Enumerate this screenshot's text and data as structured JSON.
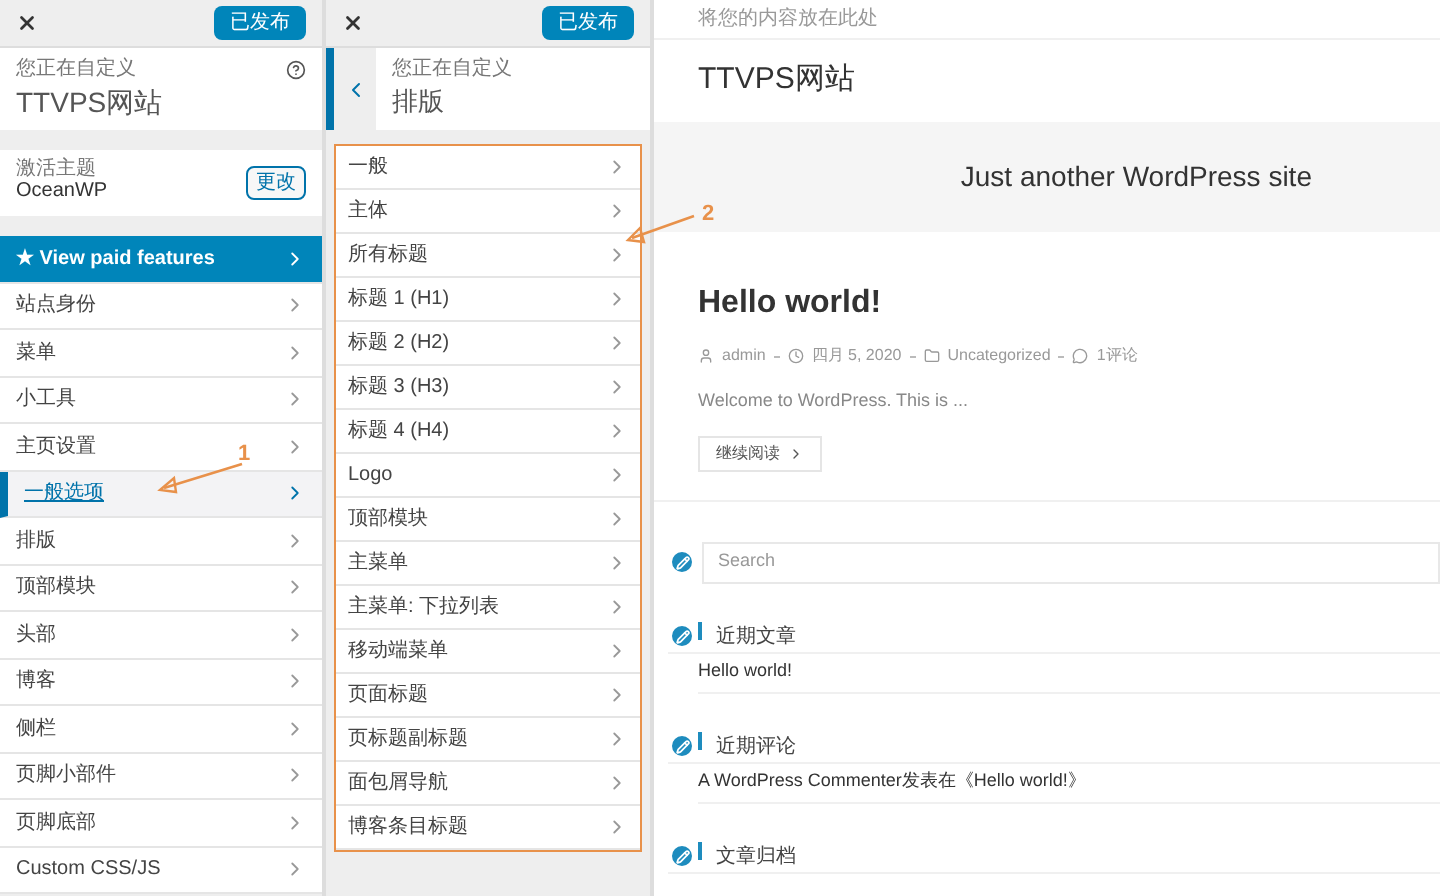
{
  "panel_1": {
    "publish_button": "已发布",
    "customizing_label": "您正在自定义",
    "site_title": "TTVPS网站",
    "active_theme": {
      "label": "激活主题",
      "name": "OceanWP",
      "button": "更改"
    },
    "items": [
      {
        "label": "★ View paid features",
        "kind": "promo",
        "selected": false
      },
      {
        "label": "站点身份",
        "kind": "section",
        "selected": false
      },
      {
        "label": "菜单",
        "kind": "section",
        "selected": false
      },
      {
        "label": "小工具",
        "kind": "section",
        "selected": false
      },
      {
        "label": "主页设置",
        "kind": "section",
        "selected": false
      },
      {
        "label": "一般选项",
        "kind": "section",
        "selected": true
      },
      {
        "label": "排版",
        "kind": "section",
        "selected": false
      },
      {
        "label": "顶部模块",
        "kind": "section",
        "selected": false
      },
      {
        "label": "头部",
        "kind": "section",
        "selected": false
      },
      {
        "label": "博客",
        "kind": "section",
        "selected": false
      },
      {
        "label": "侧栏",
        "kind": "section",
        "selected": false
      },
      {
        "label": "页脚小部件",
        "kind": "section",
        "selected": false
      },
      {
        "label": "页脚底部",
        "kind": "section",
        "selected": false
      },
      {
        "label": "Custom CSS/JS",
        "kind": "section",
        "selected": false
      }
    ]
  },
  "panel_2": {
    "publish_button": "已发布",
    "customizing_label": "您正在自定义",
    "section_title": "排版",
    "outlined": true,
    "items": [
      "一般",
      "主体",
      "所有标题",
      "标题 1 (H1)",
      "标题 2 (H2)",
      "标题 3 (H3)",
      "标题 4 (H4)",
      "Logo",
      "顶部模块",
      "主菜单",
      "主菜单: 下拉列表",
      "移动端菜单",
      "页面标题",
      "页标题副标题",
      "面包屑导航",
      "博客条目标题"
    ]
  },
  "preview": {
    "top_notice": "将您的内容放在此处",
    "site_title": "TTVPS网站",
    "tagline": "Just another WordPress site",
    "post": {
      "title": "Hello world!",
      "author": "admin",
      "date": "四月 5, 2020",
      "category": "Uncategorized",
      "comments": "1评论",
      "excerpt": "Welcome to WordPress. This is ...",
      "read_more": "继续阅读"
    },
    "search_placeholder": "Search",
    "widgets": [
      {
        "title": "近期文章",
        "items": [
          "Hello world!"
        ]
      },
      {
        "title": "近期评论",
        "items": [
          "A WordPress Commenter发表在《Hello world!》"
        ]
      },
      {
        "title": "文章归档"
      }
    ]
  },
  "annotations": [
    {
      "label": "1"
    },
    {
      "label": "2"
    }
  ]
}
